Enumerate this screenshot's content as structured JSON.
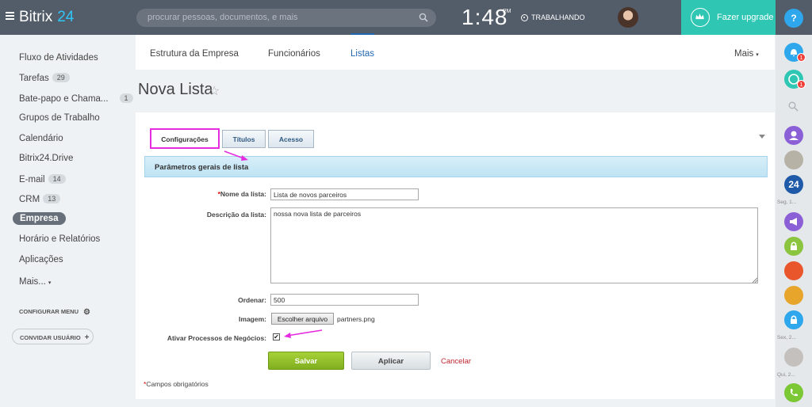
{
  "header": {
    "logo_text": "Bitrix",
    "logo_num": "24",
    "search_placeholder": "procurar pessoas, documentos, e mais",
    "time": "1:48",
    "ampm": "PM",
    "status": "TRABALHANDO",
    "upgrade_label": "Fazer upgrade",
    "help": "?"
  },
  "menu": {
    "items": [
      {
        "label": "Fluxo de Atividades"
      },
      {
        "label": "Tarefas",
        "count": "29"
      },
      {
        "label": "Bate-papo e Chama...",
        "count": "1"
      },
      {
        "label": "Grupos de Trabalho"
      },
      {
        "label": "Calendário"
      },
      {
        "label": "Bitrix24.Drive"
      },
      {
        "label": "E-mail",
        "count": "14"
      },
      {
        "label": "CRM",
        "count": "13"
      },
      {
        "label": "Empresa"
      },
      {
        "label": "Horário e Relatórios"
      },
      {
        "label": "Aplicações"
      },
      {
        "label": "Mais..."
      }
    ],
    "configure": "CONFIGURAR MENU",
    "invite": "CONVIDAR USUÁRIO"
  },
  "nav": {
    "tabs": [
      "Estrutura da Empresa",
      "Funcionários",
      "Listas"
    ],
    "more": "Mais"
  },
  "page": {
    "title": "Nova Lista"
  },
  "form": {
    "tabs": [
      "Configurações",
      "Títulos",
      "Acesso"
    ],
    "section_title": "Parâmetros gerais de lista",
    "required_mark": "*",
    "name_label": "Nome da lista:",
    "name_value": "Lista de novos parceiros",
    "desc_label": "Descrição da lista:",
    "desc_value": "nossa nova lista de parceiros",
    "order_label": "Ordenar:",
    "order_value": "500",
    "image_label": "Imagem:",
    "file_button": "Escolher arquivo",
    "file_name": "partners.png",
    "bp_label": "Ativar Processos de Negócios:",
    "bp_checked": "✔",
    "save": "Salvar",
    "apply": "Aplicar",
    "cancel": "Cancelar",
    "required_note": "Campos obrigatórios"
  },
  "right_bar": {
    "labels": [
      "Seg, 1...",
      "Sex, 2...",
      "Qui, 2..."
    ],
    "badges": [
      "1",
      "1"
    ],
    "tile_24": "24"
  },
  "colors": {
    "header_bg": "#535c69",
    "accent_teal": "#2fc7b4",
    "link_blue": "#2067b0",
    "save_green": "#8dbb24",
    "annotation_magenta": "#e52ce0"
  }
}
